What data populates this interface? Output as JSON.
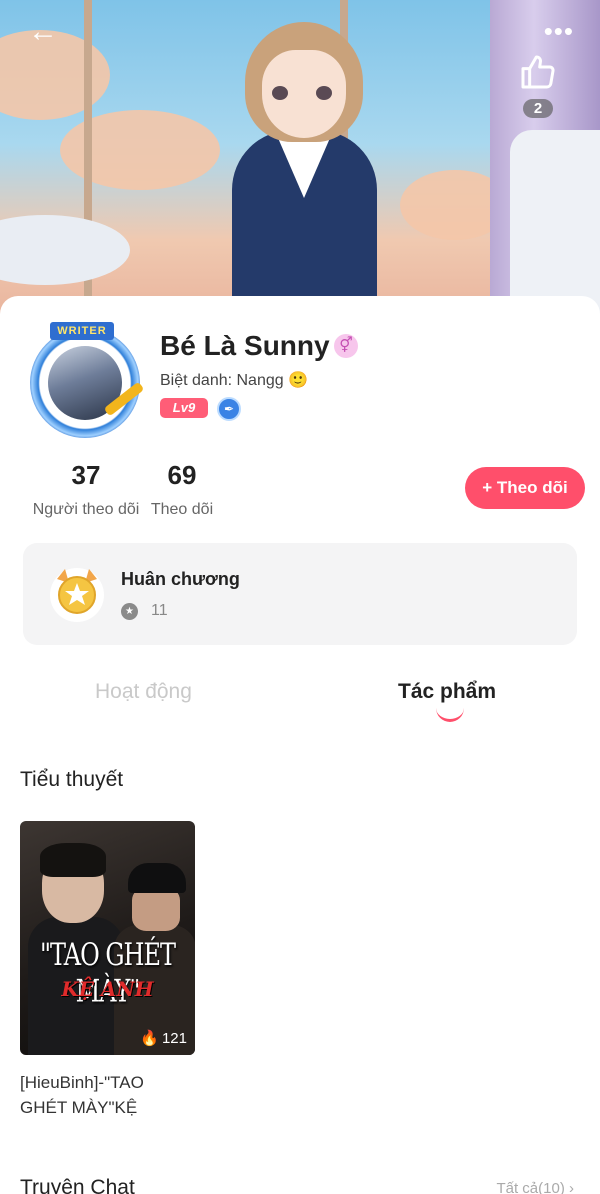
{
  "header": {
    "back_icon": "arrow-left-icon",
    "more_icon": "ellipsis-icon",
    "like_icon": "thumbs-up-icon",
    "like_count": "2"
  },
  "profile": {
    "writer_badge": "WRITER",
    "name": "Bé Là Sunny",
    "gender_symbol": "⚥",
    "nickname": "Biệt danh: Nangg 🙂",
    "level": "Lv9",
    "followers_count": "37",
    "followers_label": "Người theo dõi",
    "following_count": "69",
    "following_label": "Theo dõi",
    "follow_button": "+ Theo dõi"
  },
  "medals": {
    "title": "Huân chương",
    "count": "11"
  },
  "tabs": [
    {
      "label": "Hoạt động",
      "active": false
    },
    {
      "label": "Tác phẩm",
      "active": true
    }
  ],
  "novels": {
    "section_title": "Tiểu thuyết",
    "items": [
      {
        "cover_title_line1": "\"TAO GHÉT MÀY\"",
        "cover_title_line2": "KỆ ANH",
        "views": "121",
        "name": "[HieuBinh]-\"TAO GHÉT MÀY\"KỆ"
      }
    ]
  },
  "chat_stories": {
    "section_title": "Truyện Chat",
    "see_all": "Tất cả(10)  ›"
  },
  "colors": {
    "accent": "#ff4f6b",
    "level_badge": "#ff5d77",
    "medal_bg": "#f4f4f5"
  }
}
